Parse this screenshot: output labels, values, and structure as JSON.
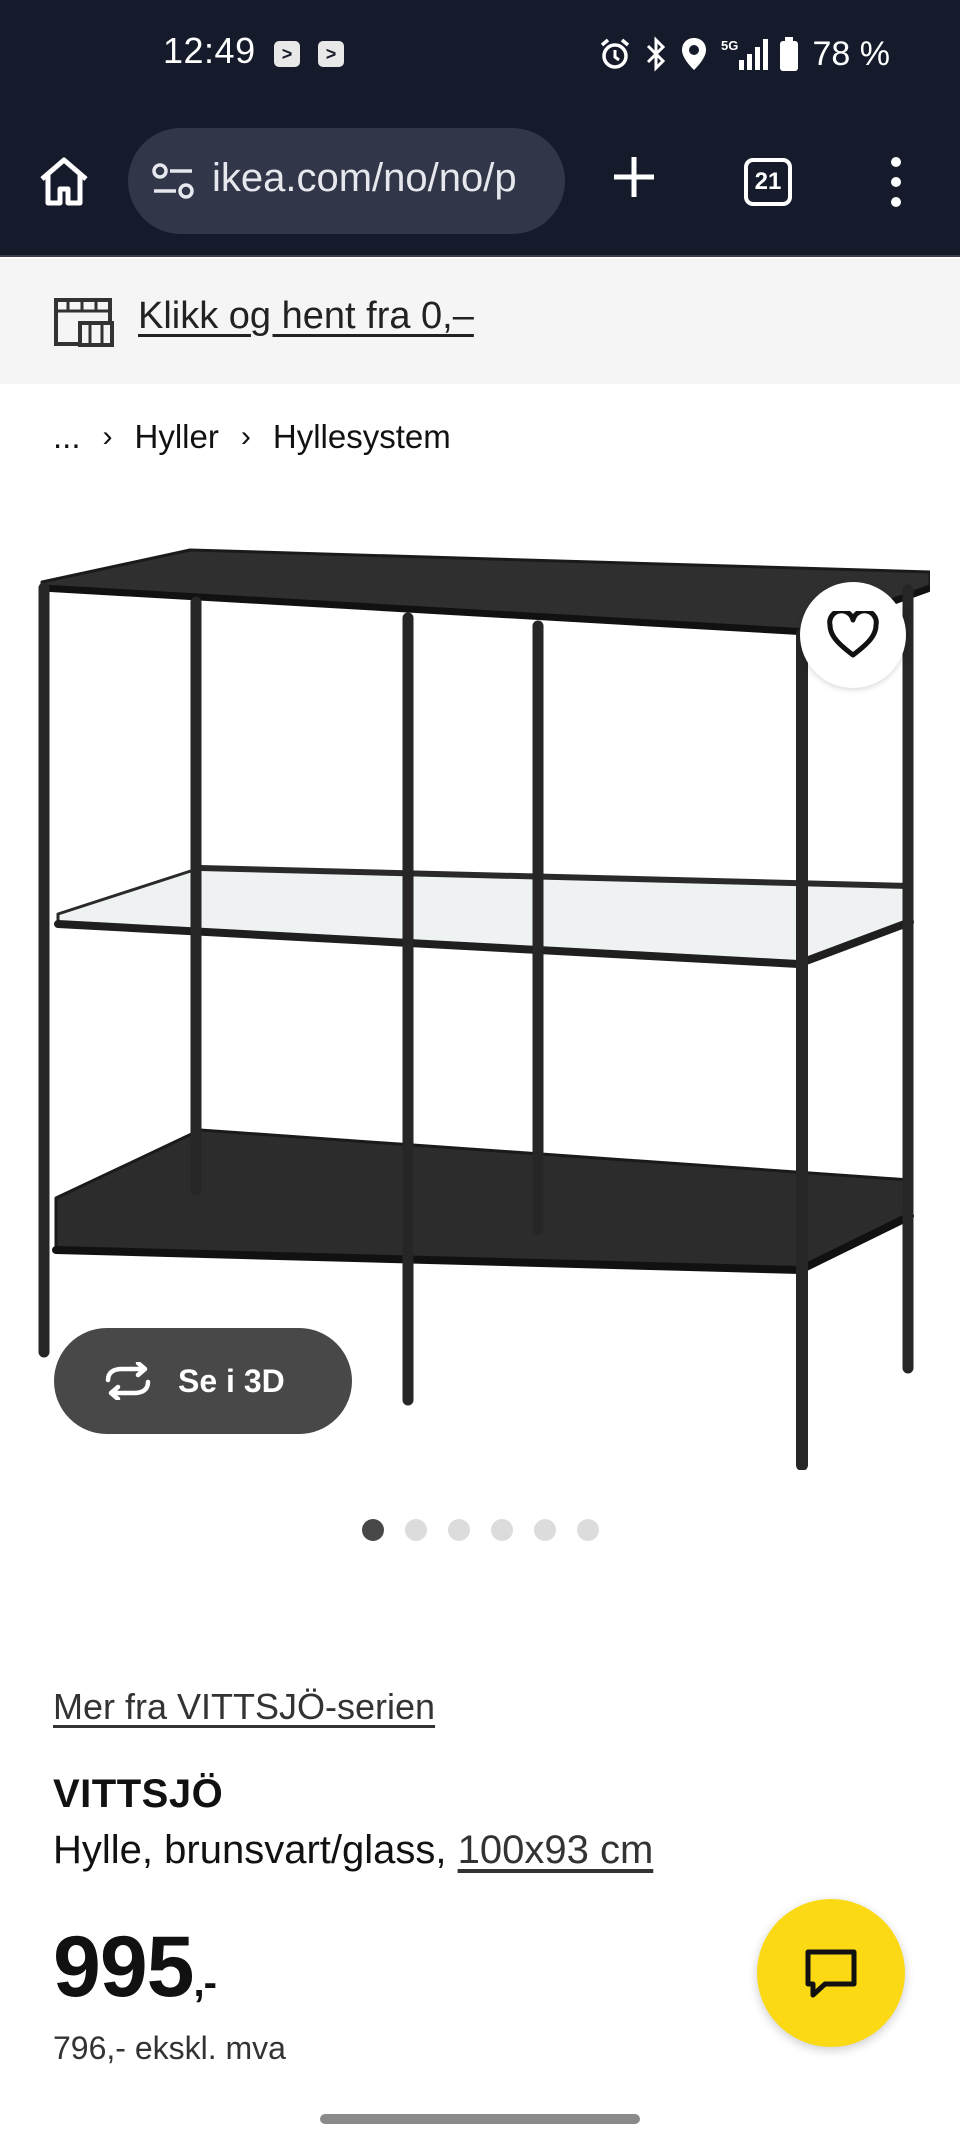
{
  "status_bar": {
    "time": "12:49",
    "notif_glyph": ">",
    "battery_text": "78 %",
    "network": "5G"
  },
  "browser": {
    "url": "ikea.com/no/no/p",
    "tab_count": "21"
  },
  "collect_banner": {
    "text": "Klikk og hent fra 0,–"
  },
  "breadcrumb": {
    "items": [
      "...",
      "Hyller",
      "Hyllesystem"
    ]
  },
  "media": {
    "view_3d_label": "Se i 3D",
    "image_count": 6,
    "active_index": 0
  },
  "product": {
    "series_link": "Mer fra VITTSJÖ-serien",
    "name": "VITTSJÖ",
    "description": "Hylle, brunsvart/glass, ",
    "size": "100x93 cm",
    "price": "995",
    "price_suffix": ",-",
    "price_ex_vat": "796,- ekskl. mva"
  },
  "colors": {
    "browser_bg": "#161b2b",
    "chat_fab": "#fbd914",
    "button_dark": "#484848"
  }
}
